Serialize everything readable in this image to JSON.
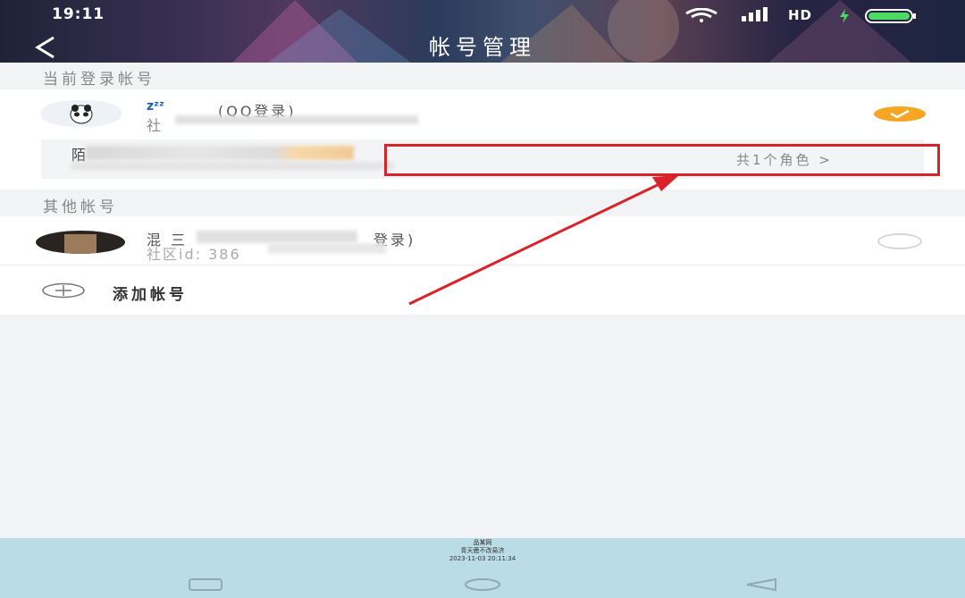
{
  "status_bar": {
    "time": "19:11",
    "network": "HD"
  },
  "header": {
    "title": "帐号管理"
  },
  "current": {
    "section_label": "当前登录帐号",
    "account": {
      "name_suffix": "(QQ登录)",
      "sub_prefix": "社"
    },
    "role_row": {
      "name_prefix": "陌",
      "count_text": "共1个角色 >"
    }
  },
  "other": {
    "section_label": "其他帐号",
    "account": {
      "name_prefix": "混 三",
      "name_suffix": "登录)",
      "sub_text": "社区id: 386"
    }
  },
  "add_account": {
    "label": "添加帐号"
  },
  "watermark": {
    "line1": "品某网",
    "line2": "青天鹿不改易济",
    "line3": "2023-11-03 20:11:34"
  },
  "colors": {
    "accent_check": "#f6a623",
    "annotation_red": "#d8232a",
    "nav_bar": "#b9dce6"
  }
}
